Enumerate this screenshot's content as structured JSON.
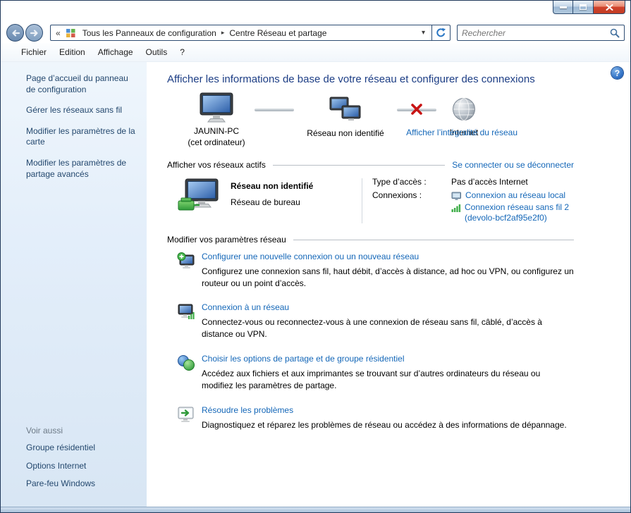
{
  "nav": {
    "chevron": "«",
    "separator": "▸",
    "dropdown": "▾",
    "crumbs": [
      "Tous les Panneaux de configuration",
      "Centre Réseau et partage"
    ],
    "search_placeholder": "Rechercher"
  },
  "menubar": {
    "items": [
      "Fichier",
      "Edition",
      "Affichage",
      "Outils",
      "?"
    ]
  },
  "sidebar": {
    "items": [
      "Page d’accueil du panneau de configuration",
      "Gérer les réseaux sans fil",
      "Modifier les paramètres de la carte",
      "Modifier les paramètres de partage avancés"
    ],
    "see_also_header": "Voir aussi",
    "see_also_items": [
      "Groupe résidentiel",
      "Options Internet",
      "Pare-feu Windows"
    ]
  },
  "main": {
    "help_glyph": "?",
    "title": "Afficher les informations de base de votre réseau et configurer des connexions",
    "map": {
      "pc_label": "JAUNIN-PC",
      "pc_sublabel": "(cet ordinateur)",
      "network_label": "Réseau non identifié",
      "internet_label": "Internet",
      "full_map_link": "Afficher l’intégralité du réseau"
    },
    "active_networks": {
      "header": "Afficher vos réseaux actifs",
      "connect_link": "Se connecter ou se déconnecter",
      "network_name": "Réseau non identifié",
      "network_type": "Réseau de bureau",
      "access_type_label": "Type d’accès :",
      "access_type_value": "Pas d’accès Internet",
      "connections_label": "Connexions :",
      "connection_links": [
        "Connexion au réseau local",
        "Connexion réseau sans fil 2 (devolo-bcf2af95e2f0)"
      ]
    },
    "settings": {
      "header": "Modifier vos paramètres réseau",
      "items": [
        {
          "title": "Configurer une nouvelle connexion ou un nouveau réseau",
          "desc": "Configurez une connexion sans fil, haut débit, d’accès à distance, ad hoc ou VPN, ou configurez un routeur ou un point d’accès."
        },
        {
          "title": "Connexion à un réseau",
          "desc": "Connectez-vous ou reconnectez-vous à une connexion de réseau sans fil, câblé, d’accès à distance ou VPN."
        },
        {
          "title": "Choisir les options de partage et de groupe résidentiel",
          "desc": "Accédez aux fichiers et aux imprimantes se trouvant sur d’autres ordinateurs du réseau ou modifiez les paramètres de partage."
        },
        {
          "title": "Résoudre les problèmes",
          "desc": "Diagnostiquez et réparez les problèmes de réseau ou accédez à des informations de dépannage."
        }
      ]
    }
  }
}
